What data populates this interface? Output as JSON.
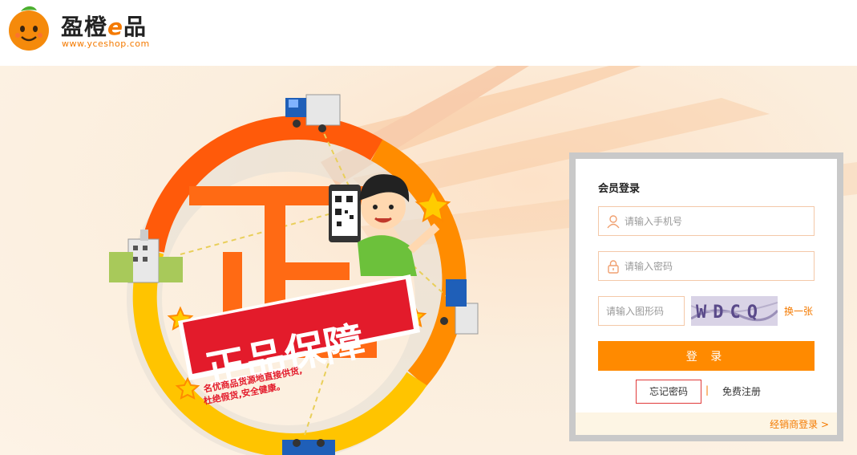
{
  "brand": {
    "name_main": "盈橙",
    "name_e": "e",
    "name_tail": "品",
    "url": "www.yceshop.com",
    "accent": "#f47a00"
  },
  "banner": {
    "headline": "正品保障",
    "sub_line1": "名优商品货源地直接供货,",
    "sub_line2": "杜绝假货,安全健康。",
    "big_char": "正"
  },
  "login": {
    "title": "会员登录",
    "phone_placeholder": "请输入手机号",
    "password_placeholder": "请输入密码",
    "captcha_placeholder": "请输入图形码",
    "captcha_text": "WDCQ",
    "swap_label": "换一张",
    "submit_label": "登 录",
    "forgot_label": "忘记密码",
    "separator": "|",
    "register_label": "免费注册",
    "dealer_label": "经销商登录 >"
  }
}
